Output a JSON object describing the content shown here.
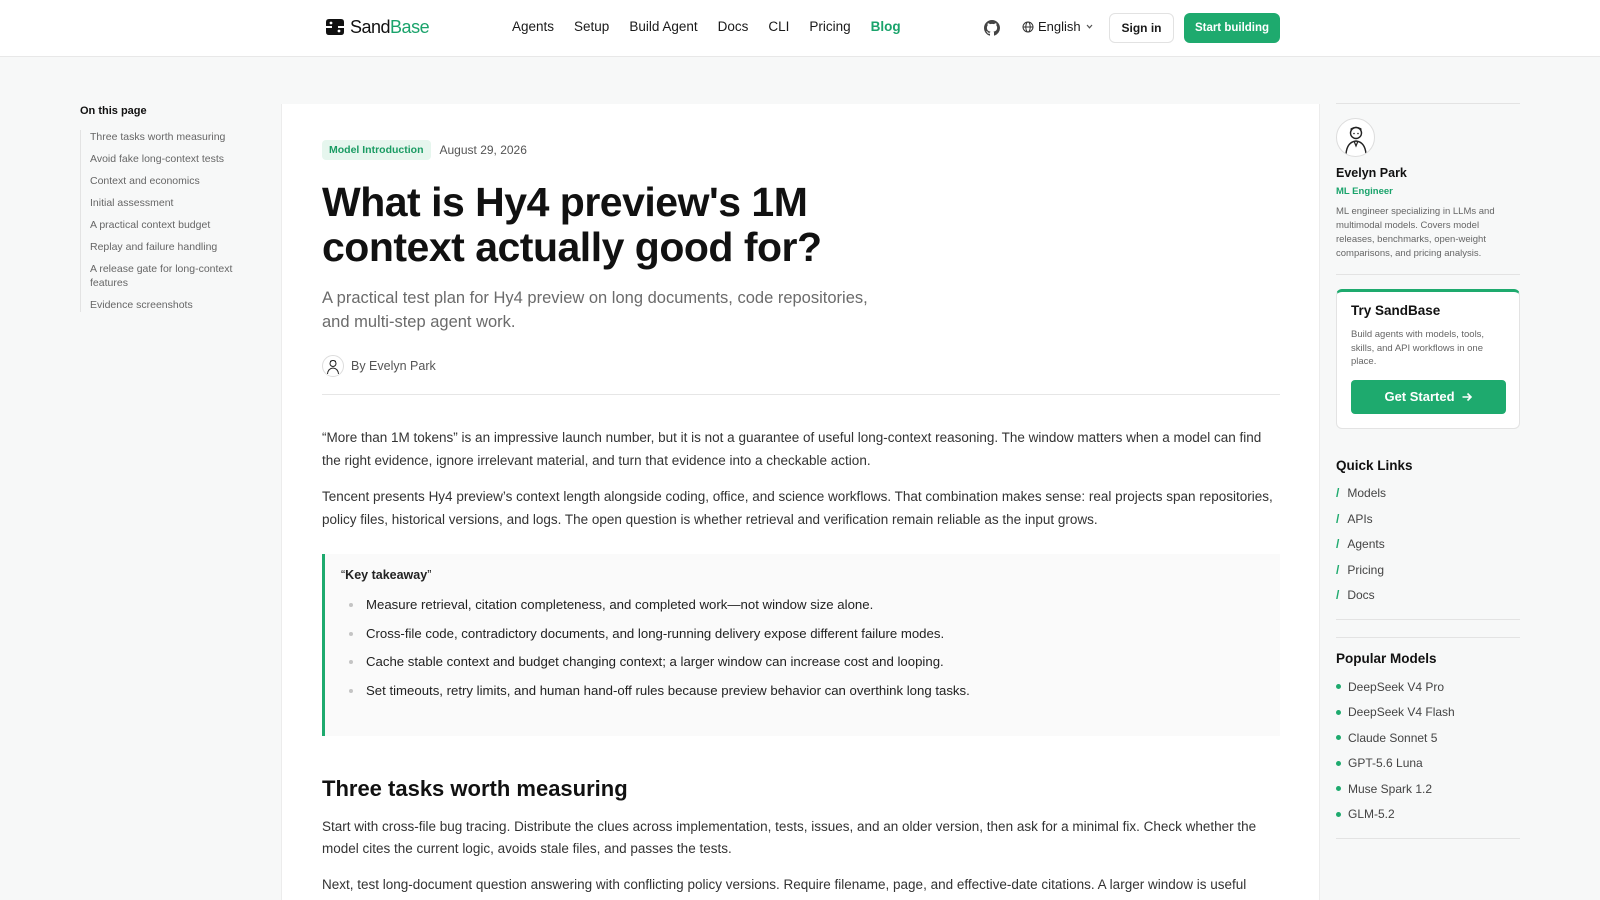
{
  "header": {
    "logo_text_a": "Sand",
    "logo_text_b": "Base",
    "nav": [
      "Agents",
      "Setup",
      "Build Agent",
      "Docs",
      "CLI",
      "Pricing",
      "Blog"
    ],
    "active_nav": "Blog",
    "language": "English",
    "signin_label": "Sign in",
    "start_label": "Start building"
  },
  "toc": {
    "title": "On this page",
    "items": [
      "Three tasks worth measuring",
      "Avoid fake long-context tests",
      "Context and economics",
      "Initial assessment",
      "A practical context budget",
      "Replay and failure handling",
      "A release gate for long-context features",
      "Evidence screenshots"
    ]
  },
  "article": {
    "tag": "Model Introduction",
    "date": "August 29, 2026",
    "title": "What is Hy4 preview's 1M context actually good for?",
    "subtitle": "A practical test plan for Hy4 preview on long documents, code repositories, and multi-step agent work.",
    "byline": "By Evelyn Park",
    "para1": "“More than 1M tokens” is an impressive launch number, but it is not a guarantee of useful long-context reasoning. The window matters when a model can find the right evidence, ignore irrelevant material, and turn that evidence into a checkable action.",
    "para2": "Tencent presents Hy4 preview’s context length alongside coding, office, and science workflows. That combination makes sense: real projects span repositories, policy files, historical versions, and logs. The open question is whether retrieval and verification remain reliable as the input grows.",
    "takeaway_open": "“",
    "takeaway_title": "Key takeaway",
    "takeaway_close": "”",
    "takeaways": [
      "Measure retrieval, citation completeness, and completed work—not window size alone.",
      "Cross-file code, contradictory documents, and long-running delivery expose different failure modes.",
      "Cache stable context and budget changing context; a larger window can increase cost and looping.",
      "Set timeouts, retry limits, and human hand-off rules because preview behavior can overthink long tasks."
    ],
    "section1": "Three tasks worth measuring",
    "para3": "Start with cross-file bug tracing. Distribute the clues across implementation, tests, issues, and an older version, then ask for a minimal fix. Check whether the model cites the current logic, avoids stale files, and passes the tests.",
    "para4": "Next, test long-document question answering with conflicting policy versions. Require filename, page, and effective-date citations. A larger window is useful"
  },
  "sidebar": {
    "author_name": "Evelyn Park",
    "author_role": "ML Engineer",
    "author_bio": "ML engineer specializing in LLMs and multimodal models. Covers model releases, benchmarks, open-weight comparisons, and pricing analysis.",
    "try_title": "Try SandBase",
    "try_desc": "Build agents with models, tools, skills, and API workflows in one place.",
    "get_started": "Get Started",
    "quick_links_title": "Quick Links",
    "quick_links": [
      "Models",
      "APIs",
      "Agents",
      "Pricing",
      "Docs"
    ],
    "popular_title": "Popular Models",
    "popular_models": [
      "DeepSeek V4 Pro",
      "DeepSeek V4 Flash",
      "Claude Sonnet 5",
      "GPT-5.6 Luna",
      "Muse Spark 1.2",
      "GLM-5.2"
    ]
  },
  "colors": {
    "accent": "#1eaa6e",
    "tag_bg": "#e6f6ee"
  }
}
